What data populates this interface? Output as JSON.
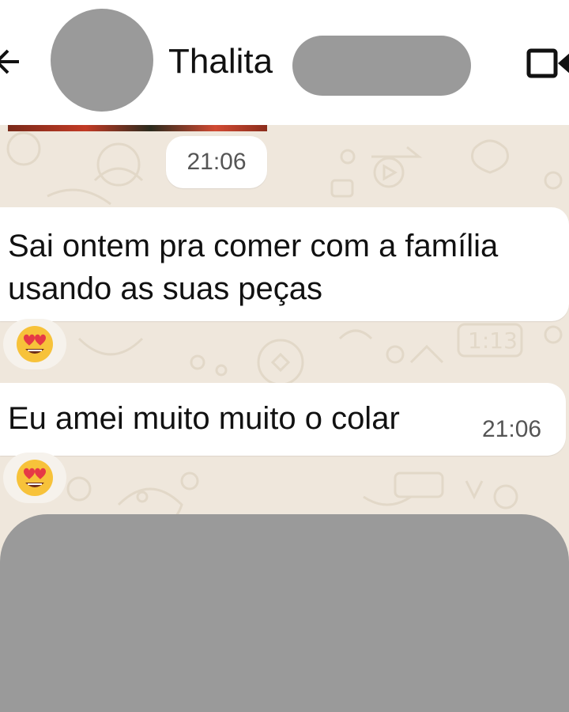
{
  "header": {
    "contact_name": "Thalita",
    "icons": {
      "back": "arrow-left-icon",
      "video": "video-camera-icon"
    }
  },
  "chat": {
    "date_chip": "21:06",
    "messages": [
      {
        "text": "Sai ontem pra comer com a família usando as suas peças",
        "time": "",
        "reaction": "😍"
      },
      {
        "text": "Eu amei muito muito o colar",
        "time": "21:06",
        "reaction": "😍"
      }
    ]
  },
  "colors": {
    "header_bg": "#ffffff",
    "chat_bg": "#efe7dc",
    "bubble_bg": "#ffffff",
    "redaction": "#9a9a9a",
    "doodle": "#e0d6c6"
  }
}
